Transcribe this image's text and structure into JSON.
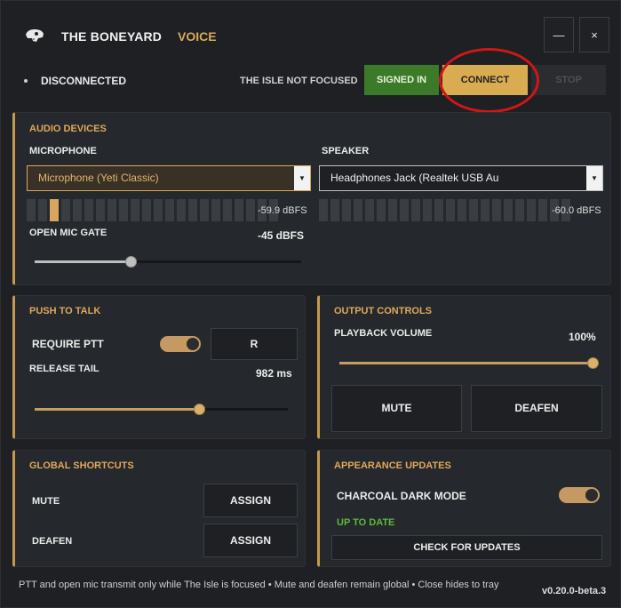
{
  "app": {
    "title": "THE BONEYARD",
    "subtitle": "VOICE",
    "minimize": "—",
    "close": "×",
    "logo": "dinosaur-skull-logo"
  },
  "status": {
    "connection": "DISCONNECTED",
    "focus": "THE ISLE NOT FOCUSED"
  },
  "actions": {
    "signed_in": "SIGNED IN",
    "connect": "CONNECT",
    "stop": "STOP"
  },
  "colors": {
    "accent": "#d9a95a",
    "signed_in": "#3b7a28",
    "connect": "#d9ac52",
    "annotation": "#d11616",
    "up_to_date": "#5fb83c"
  },
  "audio": {
    "title": "AUDIO DEVICES",
    "microphone": {
      "label": "MICROPHONE",
      "device": "Microphone (Yeti Classic)",
      "level": "-59.9 dBFS",
      "active_segment": 3,
      "segments": 22
    },
    "speaker": {
      "label": "SPEAKER",
      "device": "Headphones Jack (Realtek USB Au",
      "level": "-60.0 dBFS",
      "active_segment": 0,
      "segments": 22
    },
    "gate": {
      "label": "OPEN MIC GATE",
      "value": "-45 dBFS",
      "fraction": 0.36
    }
  },
  "ptt": {
    "title": "PUSH TO TALK",
    "require_label": "REQUIRE PTT",
    "require_on": true,
    "key": "R",
    "tail_label": "RELEASE TAIL",
    "tail_value": "982 ms",
    "tail_fraction": 0.65
  },
  "output": {
    "title": "OUTPUT  CONTROLS",
    "volume_label": "PLAYBACK VOLUME",
    "volume_value": "100%",
    "volume_fraction": 1.0,
    "mute": "MUTE",
    "deafen": "DEAFEN"
  },
  "shortcuts": {
    "title": "GLOBAL SHORTCUTS",
    "rows": [
      {
        "label": "MUTE",
        "button": "ASSIGN"
      },
      {
        "label": "DEAFEN",
        "button": "ASSIGN"
      }
    ]
  },
  "appearance": {
    "title": "APPEARANCE  UPDATES",
    "dark_mode_label": "CHARCOAL DARK MODE",
    "dark_mode_on": true,
    "update_status": "UP TO DATE",
    "check_button": "CHECK FOR UPDATES"
  },
  "footer": {
    "note": "PTT and open mic transmit only while The Isle is focused • Mute and deafen remain global • Close hides to tray",
    "version": "v0.20.0-beta.3"
  }
}
